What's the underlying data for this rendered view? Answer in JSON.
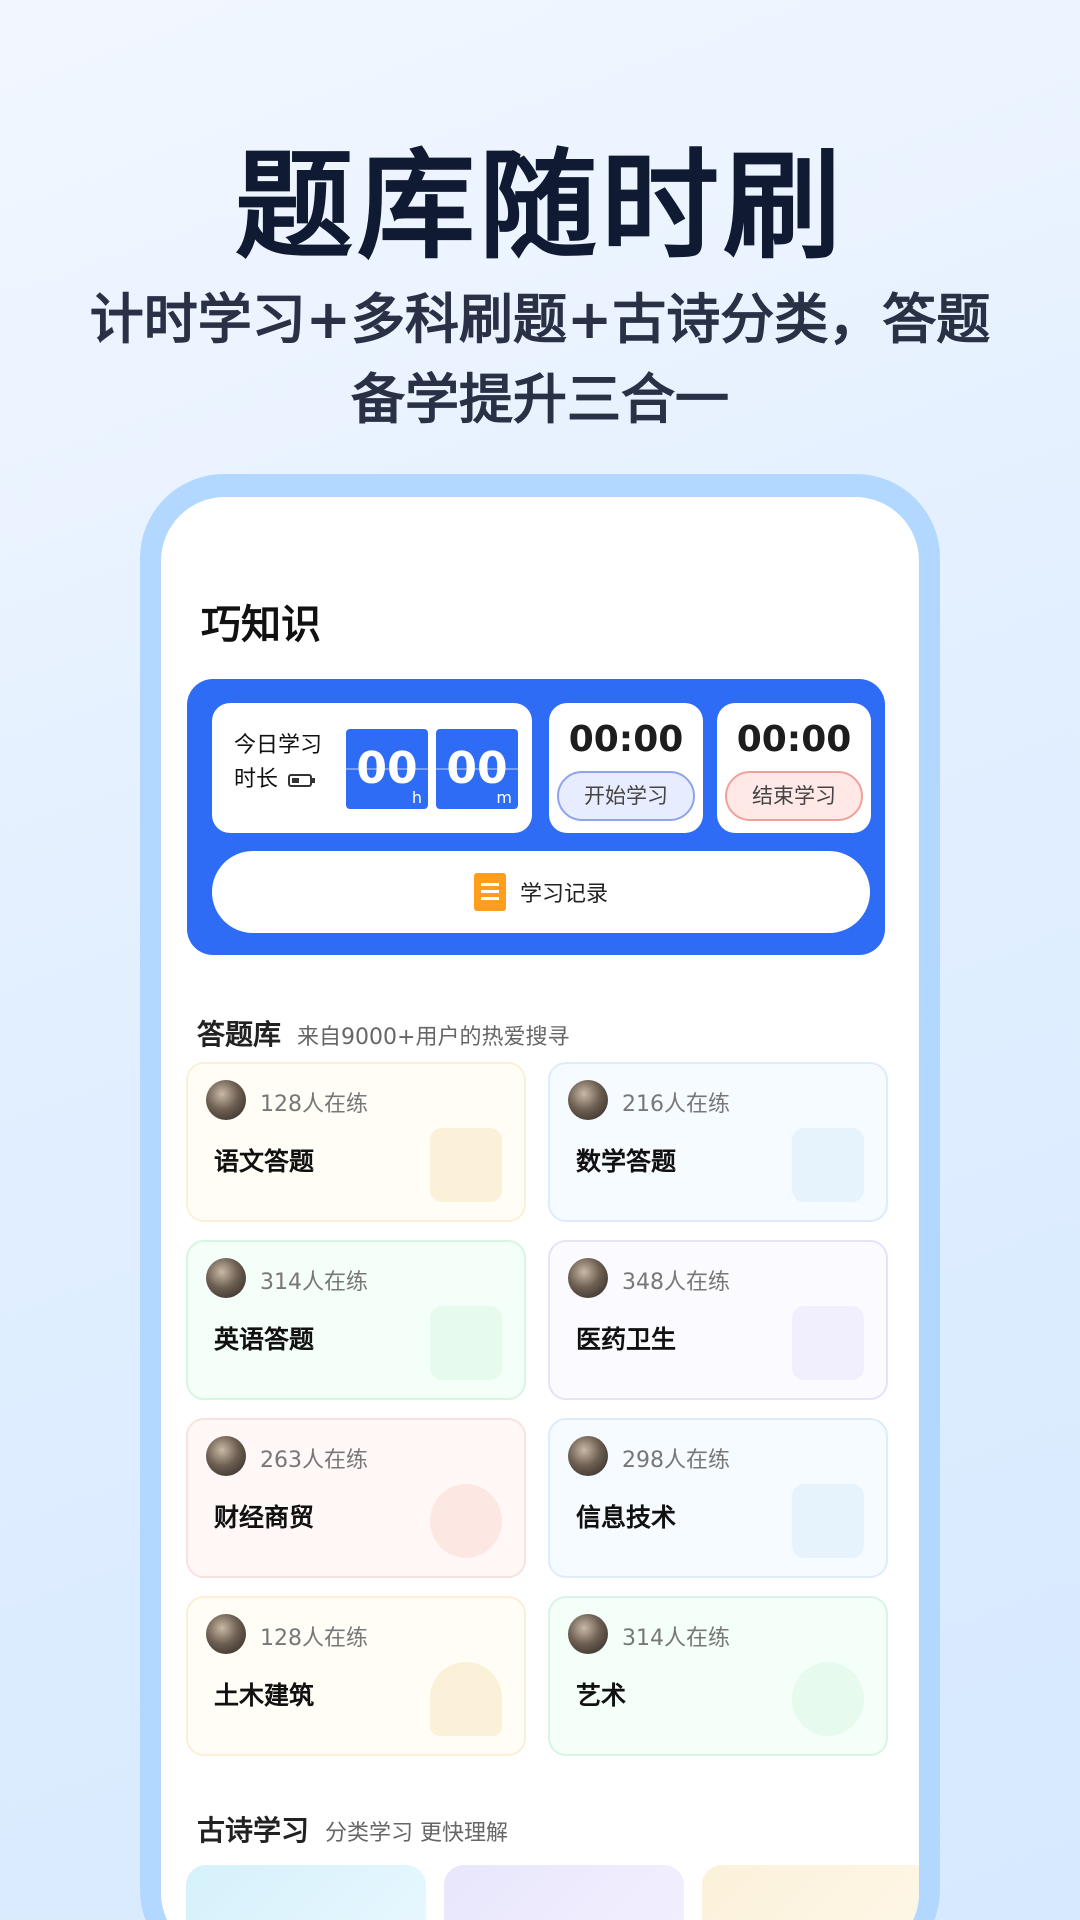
{
  "hero": {
    "title": "题库随时刷",
    "subtitle_line1": "计时学习+多科刷题+古诗分类，答题",
    "subtitle_line2": "备学提升三合一"
  },
  "app": {
    "title": "巧知识"
  },
  "timer": {
    "today_label_line1": "今日学习",
    "today_label_line2": "时长",
    "hours": "00",
    "hours_unit": "h",
    "minutes": "00",
    "minutes_unit": "m",
    "start_time": "00:00",
    "start_label": "开始学习",
    "end_time": "00:00",
    "end_label": "结束学习",
    "record_label": "学习记录"
  },
  "question_bank": {
    "heading": "答题库",
    "subheading": "来自9000+用户的热爱搜寻",
    "items": [
      {
        "name": "语文答题",
        "count": "128人在练",
        "icon": "chinese-char-icon"
      },
      {
        "name": "数学答题",
        "count": "216人在练",
        "icon": "calculator-icon"
      },
      {
        "name": "英语答题",
        "count": "314人在练",
        "icon": "letters-aa-icon"
      },
      {
        "name": "医药卫生",
        "count": "348人在练",
        "icon": "medical-kit-icon"
      },
      {
        "name": "财经商贸",
        "count": "263人在练",
        "icon": "finance-icon"
      },
      {
        "name": "信息技术",
        "count": "298人在练",
        "icon": "monitor-icon"
      },
      {
        "name": "土木建筑",
        "count": "128人在练",
        "icon": "worker-helmet-icon"
      },
      {
        "name": "艺术",
        "count": "314人在练",
        "icon": "palette-icon"
      }
    ]
  },
  "poetry": {
    "heading": "古诗学习",
    "subheading": "分类学习 更快理解"
  },
  "colors": {
    "accent": "#2e6cf6",
    "phone_frame": "#b3d8ff",
    "card_yellow": "#fffdf5",
    "card_blue": "#f6fbff",
    "card_green": "#f5fff9",
    "card_purple": "#fbfaff",
    "card_pink": "#fff8f7"
  }
}
